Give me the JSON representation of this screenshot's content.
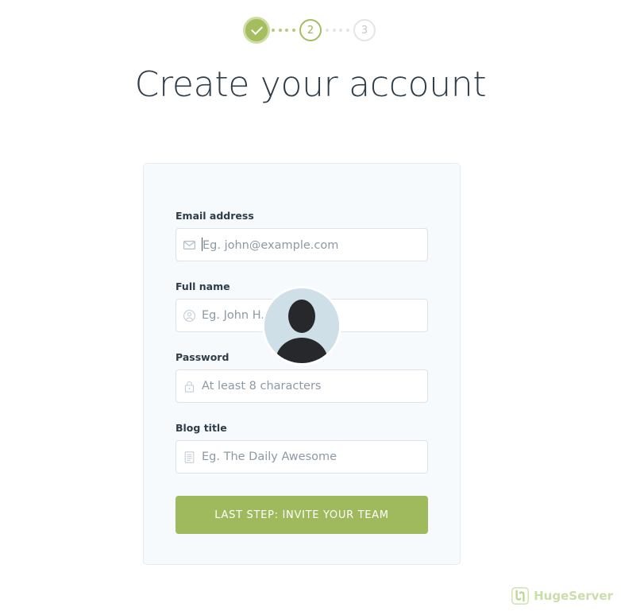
{
  "page": {
    "title": "Create your account",
    "background": "#ffffff"
  },
  "colors": {
    "accent_green": "#9fba5c",
    "step_active": "#a3bd5f",
    "step_ring": "#cfdda5",
    "step_inactive": "#e3e5e7",
    "card_bg": "#f7fafc",
    "card_border": "#e6ecf0",
    "title_text": "#2e3d49",
    "placeholder_text": "#8d99a4",
    "avatar_bg": "#cfdfe8",
    "watermark": "#c5dba2"
  },
  "stepper": {
    "steps": [
      {
        "label": "",
        "state": "completed",
        "icon": "check-icon"
      },
      {
        "label": "2",
        "state": "current",
        "icon": ""
      },
      {
        "label": "3",
        "state": "upcoming",
        "icon": ""
      }
    ],
    "connectors": [
      {
        "state": "completed",
        "dots": 4
      },
      {
        "state": "upcoming",
        "dots": 4
      }
    ]
  },
  "avatar": {
    "icon": "user-avatar-placeholder",
    "alt": "Profile photo placeholder"
  },
  "form": {
    "fields": [
      {
        "label": "Email address",
        "placeholder": "Eg. john@example.com",
        "value": "",
        "icon": "envelope-icon",
        "name": "email",
        "focused": true
      },
      {
        "label": "Full name",
        "placeholder": "Eg. John H. Watson",
        "value": "",
        "icon": "user-circle-icon",
        "name": "full-name",
        "focused": false
      },
      {
        "label": "Password",
        "placeholder": "At least 8 characters",
        "value": "",
        "icon": "lock-icon",
        "name": "password",
        "focused": false
      },
      {
        "label": "Blog title",
        "placeholder": "Eg. The Daily Awesome",
        "value": "",
        "icon": "document-icon",
        "name": "blog-title",
        "focused": false
      }
    ],
    "submit_label": "LAST STEP: INVITE YOUR TEAM"
  },
  "watermark": {
    "text": "HugeServer",
    "icon": "hugeserver-logo-icon"
  }
}
